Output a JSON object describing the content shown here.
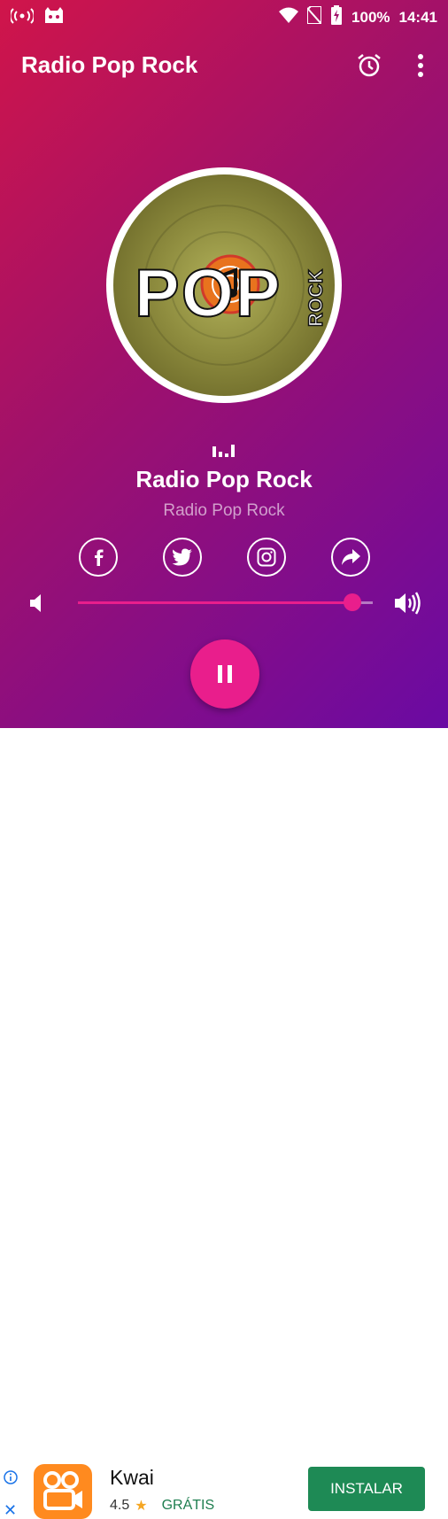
{
  "statusbar": {
    "battery": "100%",
    "time": "14:41"
  },
  "app": {
    "title": "Radio Pop Rock"
  },
  "logo": {
    "word": "POP",
    "sub": "ROCK"
  },
  "now_playing": {
    "station": "Radio Pop Rock",
    "subtitle": "Radio Pop Rock"
  },
  "volume": {
    "level": 0.93
  },
  "colors": {
    "accent": "#e91e8c",
    "ad_button": "#1e8a55",
    "disc": "#8c8a3d"
  },
  "ad": {
    "title": "Kwai",
    "rating": "4.5",
    "star": "★",
    "price": "GRÁTIS",
    "cta": "INSTALAR",
    "close": "✕"
  }
}
